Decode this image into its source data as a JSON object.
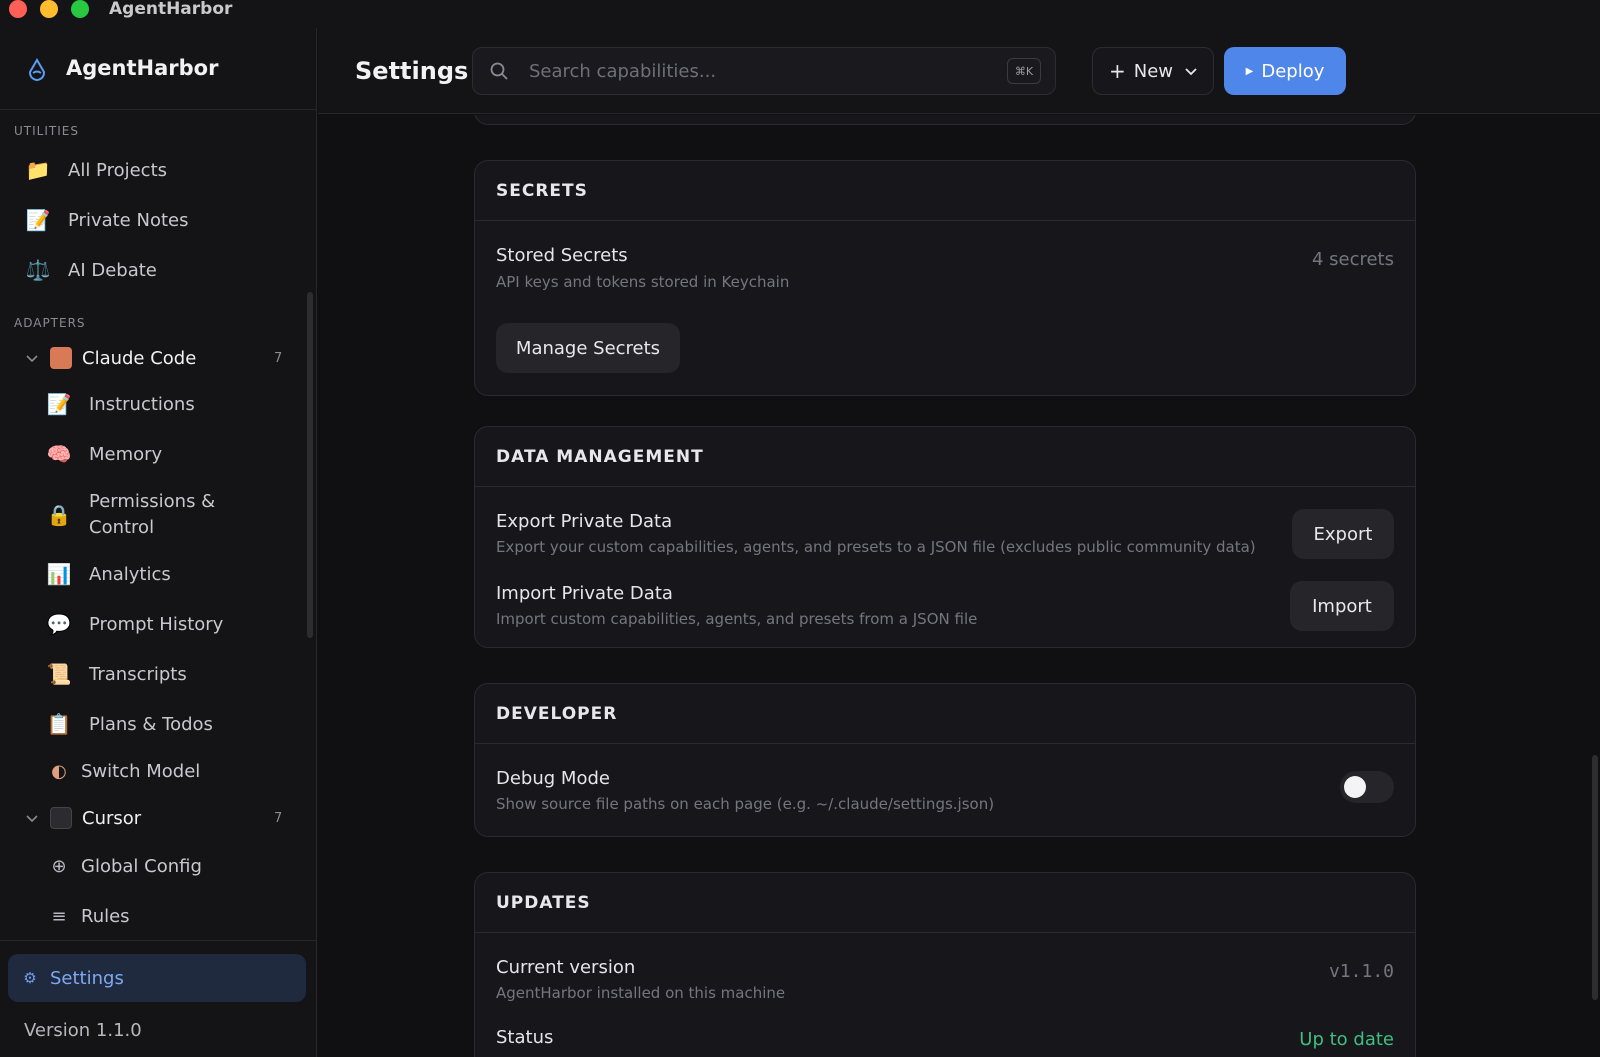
{
  "window": {
    "title": "AgentHarbor"
  },
  "sidebar": {
    "brand": "AgentHarbor",
    "utilities_label": "UTILITIES",
    "utilities": [
      {
        "label": "All Projects",
        "icon": "folder-icon",
        "glyph": "📁"
      },
      {
        "label": "Private Notes",
        "icon": "notes-icon",
        "glyph": "📝"
      },
      {
        "label": "AI Debate",
        "icon": "scales-icon",
        "glyph": "⚖️"
      }
    ],
    "adapters_label": "ADAPTERS",
    "claude": {
      "name": "Claude Code",
      "count": "7",
      "items": [
        {
          "label": "Instructions",
          "icon": "memo-icon",
          "glyph": "📝"
        },
        {
          "label": "Memory",
          "icon": "brain-icon",
          "glyph": "🧠"
        },
        {
          "label": "Permissions &",
          "label2": "Control",
          "icon": "lock-icon",
          "glyph": "🔒"
        },
        {
          "label": "Analytics",
          "icon": "bar-chart-icon",
          "glyph": "📊"
        },
        {
          "label": "Prompt History",
          "icon": "speech-bubble-icon",
          "glyph": "💬"
        },
        {
          "label": "Transcripts",
          "icon": "scroll-icon",
          "glyph": "📜"
        },
        {
          "label": "Plans & Todos",
          "icon": "clipboard-icon",
          "glyph": "📋"
        },
        {
          "label": "Switch Model",
          "icon": "switch-model-icon",
          "glyph": "◐"
        }
      ]
    },
    "cursor": {
      "name": "Cursor",
      "count": "7",
      "items": [
        {
          "label": "Global Config",
          "icon": "plus-circle-icon",
          "glyph": "⊕"
        },
        {
          "label": "Rules",
          "icon": "list-icon",
          "glyph": "≡"
        }
      ]
    },
    "settings_label": "Settings",
    "version": "Version 1.1.0"
  },
  "header": {
    "title": "Settings",
    "search_placeholder": "Search capabilities...",
    "shortcut": "⌘K",
    "new_label": "New",
    "deploy_label": "Deploy"
  },
  "secrets": {
    "heading": "SECRETS",
    "stored_title": "Stored Secrets",
    "stored_desc": "API keys and tokens stored in Keychain",
    "stored_count": "4 secrets",
    "manage_label": "Manage Secrets"
  },
  "data_management": {
    "heading": "DATA MANAGEMENT",
    "export_title": "Export Private Data",
    "export_desc": "Export your custom capabilities, agents, and presets to a JSON file (excludes public community data)",
    "export_label": "Export",
    "import_title": "Import Private Data",
    "import_desc": "Import custom capabilities, agents, and presets from a JSON file",
    "import_label": "Import"
  },
  "developer": {
    "heading": "DEVELOPER",
    "debug_title": "Debug Mode",
    "debug_desc": "Show source file paths on each page (e.g. ~/.claude/settings.json)",
    "debug_enabled": false
  },
  "updates": {
    "heading": "UPDATES",
    "current_title": "Current version",
    "current_desc": "AgentHarbor installed on this machine",
    "current_value": "v1.1.0",
    "status_title": "Status",
    "status_value": "Up to date"
  },
  "colors": {
    "accent": "#4f86ea",
    "ok": "#3fbf7f"
  }
}
